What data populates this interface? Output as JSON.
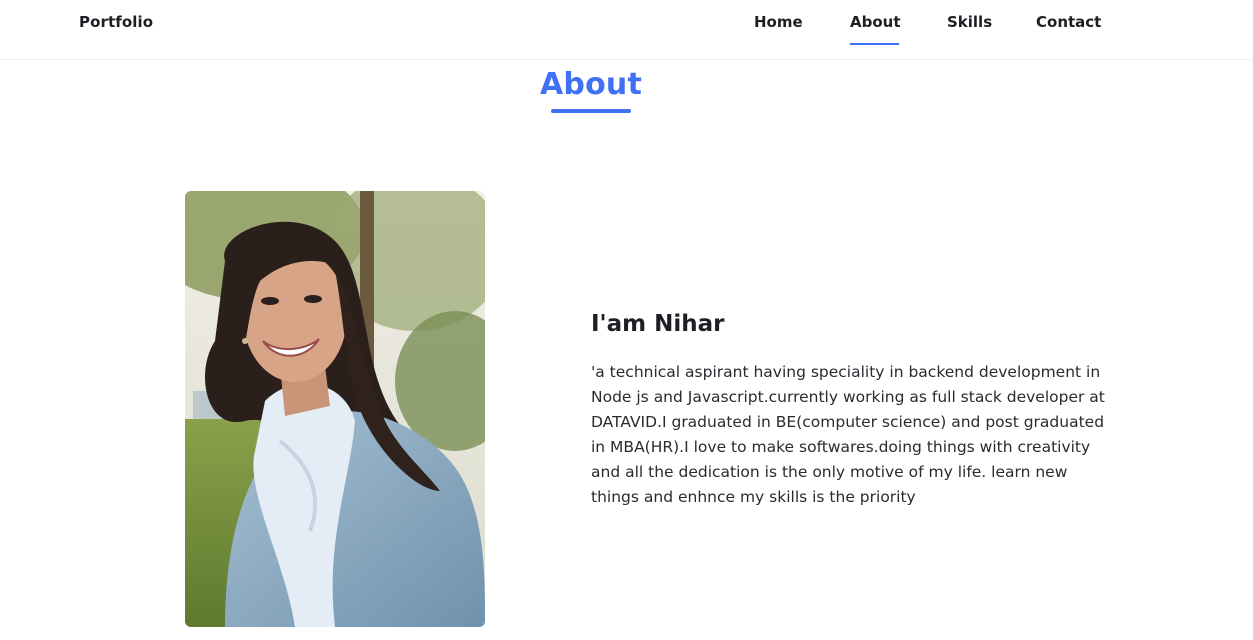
{
  "header": {
    "logo": "Portfolio",
    "nav": [
      {
        "label": "Home"
      },
      {
        "label": "About",
        "active": true
      },
      {
        "label": "Skills"
      },
      {
        "label": "Contact"
      }
    ]
  },
  "about": {
    "title": "About",
    "name": "I'am Nihar",
    "bio": "'a technical aspirant having speciality in backend development in Node js and Javascript.currently working as full stack developer at DATAVID.I graduated in BE(computer science) and post graduated in MBA(HR).I love to make softwares.doing things with creativity and all the dedication is the only motive of my life. learn new things and enhnce my skills is the priority"
  },
  "colors": {
    "accent": "#4070f4",
    "text": "#1e1f24"
  }
}
